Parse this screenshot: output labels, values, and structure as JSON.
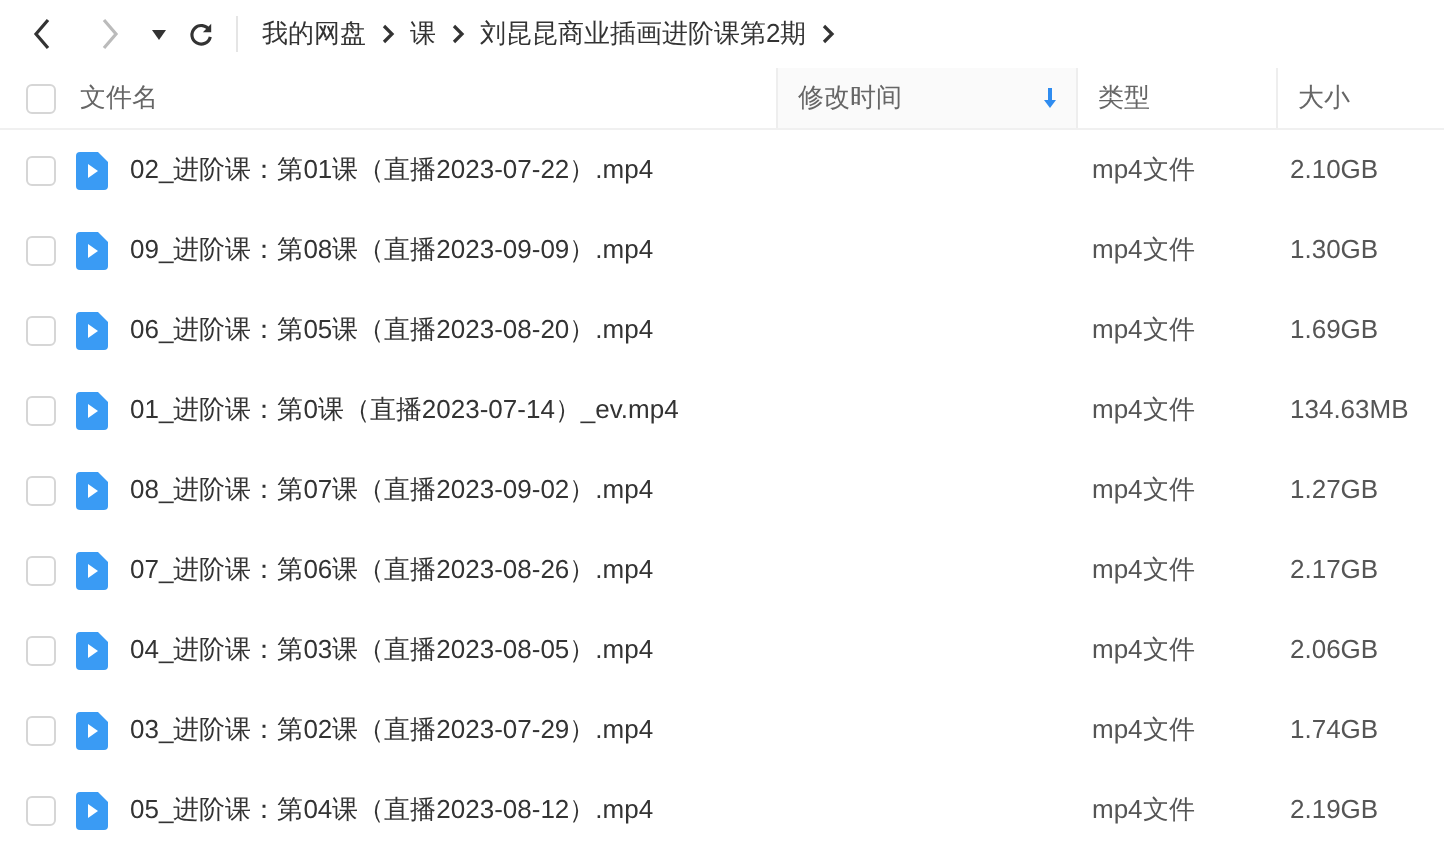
{
  "toolbar": {
    "breadcrumb": [
      {
        "label": "我的网盘"
      },
      {
        "label": "课"
      },
      {
        "label": "刘昆昆商业插画进阶课第2期"
      }
    ]
  },
  "table": {
    "select_all": {
      "checked": false
    },
    "columns": [
      {
        "label": "文件名",
        "sorted": false
      },
      {
        "label": "修改时间",
        "sorted": true
      },
      {
        "label": "类型",
        "sorted": false
      },
      {
        "label": "大小",
        "sorted": false
      }
    ],
    "rows": [
      {
        "name": "02_进阶课：第01课（直播2023-07-22）.mp4",
        "type": "mp4文件",
        "size": "2.10GB",
        "checked": false
      },
      {
        "name": "09_进阶课：第08课（直播2023-09-09）.mp4",
        "type": "mp4文件",
        "size": "1.30GB",
        "checked": false
      },
      {
        "name": "06_进阶课：第05课（直播2023-08-20）.mp4",
        "type": "mp4文件",
        "size": "1.69GB",
        "checked": false
      },
      {
        "name": "01_进阶课：第0课（直播2023-07-14）_ev.mp4",
        "type": "mp4文件",
        "size": "134.63MB",
        "checked": false
      },
      {
        "name": "08_进阶课：第07课（直播2023-09-02）.mp4",
        "type": "mp4文件",
        "size": "1.27GB",
        "checked": false
      },
      {
        "name": "07_进阶课：第06课（直播2023-08-26）.mp4",
        "type": "mp4文件",
        "size": "2.17GB",
        "checked": false
      },
      {
        "name": "04_进阶课：第03课（直播2023-08-05）.mp4",
        "type": "mp4文件",
        "size": "2.06GB",
        "checked": false
      },
      {
        "name": "03_进阶课：第02课（直播2023-07-29）.mp4",
        "type": "mp4文件",
        "size": "1.74GB",
        "checked": false
      },
      {
        "name": "05_进阶课：第04课（直播2023-08-12）.mp4",
        "type": "mp4文件",
        "size": "2.19GB",
        "checked": false
      }
    ]
  }
}
